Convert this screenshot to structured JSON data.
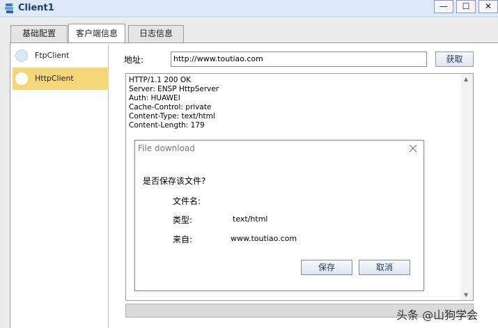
{
  "window": {
    "title": "Client1",
    "minimize_glyph": "—",
    "maximize_glyph": "☐",
    "close_glyph": "✕"
  },
  "tabs": [
    {
      "label": "基础配置"
    },
    {
      "label": "客户端信息"
    },
    {
      "label": "日志信息"
    }
  ],
  "sidebar": {
    "items": [
      {
        "label": "FtpClient",
        "selected": false
      },
      {
        "label": "HttpClient",
        "selected": true
      }
    ],
    "selected_color": "#f5d77a"
  },
  "address": {
    "label": "地址:",
    "value": "http://www.toutiao.com",
    "fetch_label": "获取"
  },
  "response": {
    "lines": [
      "HTTP/1.1 200 OK",
      "Server: ENSP HttpServer",
      "Auth: HUAWEI",
      "Cache-Control: private",
      "Content-Type: text/html",
      "Content-Length: 179"
    ]
  },
  "dialog": {
    "title": "File download",
    "question": "是否保存该文件?",
    "filename_label": "文件名:",
    "type_label": "类型:",
    "type_value": "text/html",
    "from_label": "来自:",
    "from_value": "www.toutiao.com",
    "save_label": "保存",
    "cancel_label": "取消"
  },
  "watermark": "头条 @山狗学会"
}
